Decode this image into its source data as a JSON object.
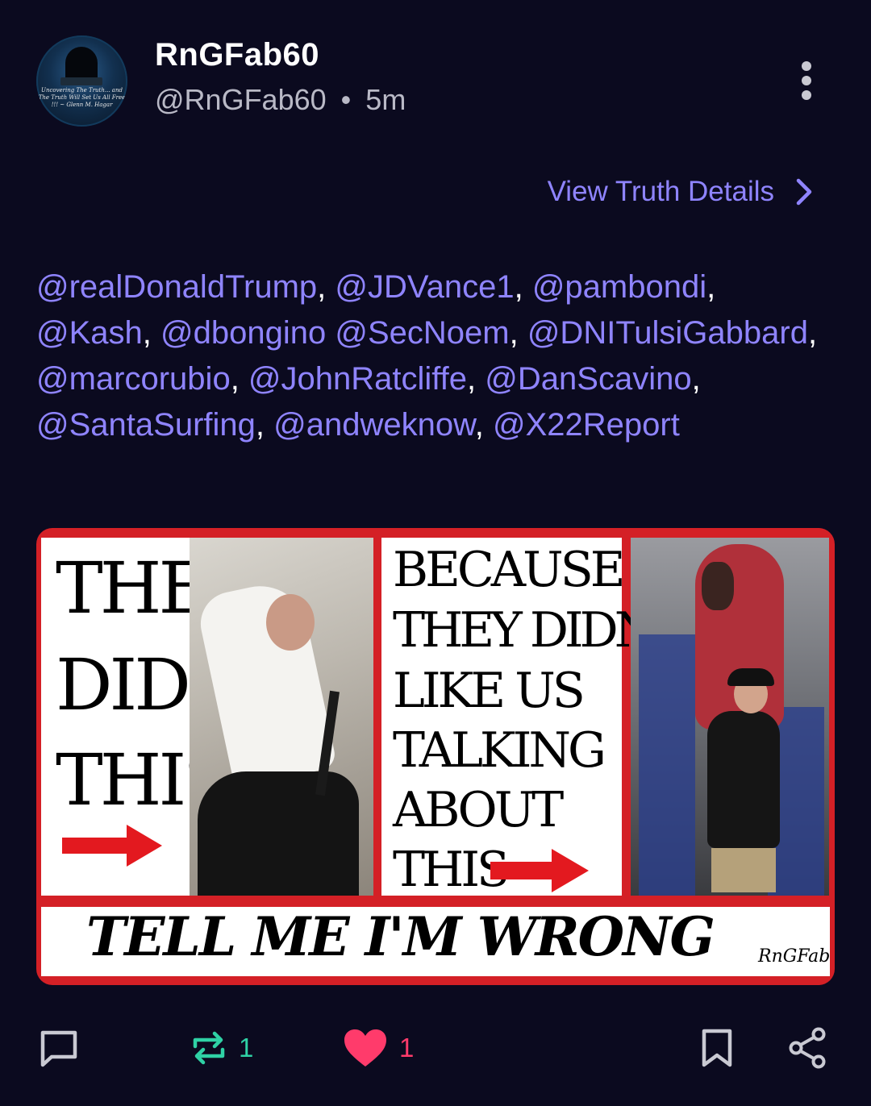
{
  "post": {
    "display_name": "RnGFab60",
    "handle": "@RnGFab60",
    "separator": "•",
    "time": "5m",
    "view_details_label": "View Truth Details",
    "avatar_caption": "Uncovering The Truth... and The Truth Will Set Us All Free !!! ~ Glenn M. Hagar"
  },
  "mentions": [
    {
      "text": "@realDonaldTrump",
      "after": ", "
    },
    {
      "text": "@JDVance1",
      "after": ", "
    },
    {
      "text": "@pambondi",
      "after": ", "
    },
    {
      "text": "@Kash",
      "after": ", "
    },
    {
      "text": "@dbongino",
      "after": " "
    },
    {
      "text": "@SecNoem",
      "after": ", "
    },
    {
      "text": "@DNITulsiGabbard",
      "after": ", "
    },
    {
      "text": "@marcorubio",
      "after": ", "
    },
    {
      "text": "@JohnRatcliffe",
      "after": ", "
    },
    {
      "text": "@DanScavino",
      "after": ", "
    },
    {
      "text": "@SantaSurfing",
      "after": ", "
    },
    {
      "text": "@andweknow",
      "after": ", "
    },
    {
      "text": "@X22Report",
      "after": ""
    }
  ],
  "meme": {
    "left_lines": [
      "THEY",
      "DID",
      "THIS"
    ],
    "middle_lines": [
      "BECAUSE",
      "THEY DIDN'T",
      "LIKE US",
      "TALKING",
      "ABOUT",
      "THIS"
    ],
    "bottom_text": "TELL ME I'M WRONG",
    "signature": "RnGFab"
  },
  "actions": {
    "retruth_count": "1",
    "like_count": "1"
  },
  "colors": {
    "background": "#0b0a1f",
    "accent": "#8f84ff",
    "retruth": "#2fd1a5",
    "like": "#ff3b6b",
    "meme_red": "#d42026"
  },
  "icons": [
    "reply-icon",
    "retruth-icon",
    "heart-icon",
    "bookmark-icon",
    "share-icon",
    "more-vertical-icon",
    "chevron-right-icon"
  ]
}
